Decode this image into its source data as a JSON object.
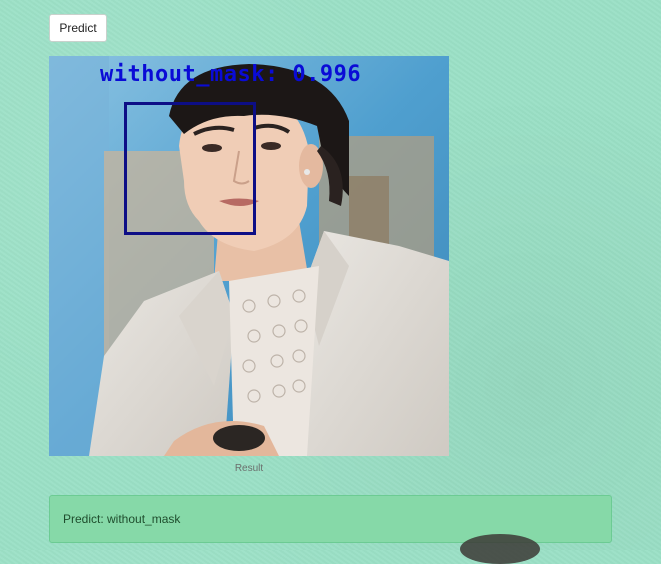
{
  "predict_button": {
    "label": "Predict"
  },
  "result": {
    "detection_label": "without_mask: 0.996",
    "caption": "Result"
  },
  "alert": {
    "text": "Predict: without_mask"
  },
  "colors": {
    "background": "#9be0c6",
    "detection_label": "#0a0bd6",
    "detection_box": "#0d0e86",
    "alert_background": "#86d9a8",
    "alert_text": "#1f4d2d"
  }
}
